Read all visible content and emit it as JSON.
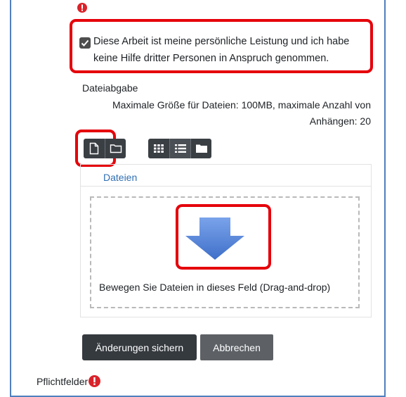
{
  "declaration": {
    "checked": true,
    "text": "Diese Arbeit ist meine persönliche Leistung und ich habe keine Hilfe dritter Personen in Anspruch genommen."
  },
  "file_submission": {
    "label": "Dateiabgabe",
    "limits": "Maximale Größe für Dateien: 100MB, maximale Anzahl von Anhängen: 20"
  },
  "toolbar": {
    "icons": [
      "file-icon",
      "folder-icon",
      "grid-view-icon",
      "list-view-icon",
      "folder-view-icon"
    ]
  },
  "file_panel": {
    "breadcrumb": "Dateien",
    "drop_text": "Bewegen Sie Dateien in dieses Feld (Drag-and-drop)"
  },
  "actions": {
    "save_label": "Änderungen sichern",
    "cancel_label": "Abbrechen"
  },
  "footer": {
    "required_label": "Pflichtfelder"
  },
  "colors": {
    "highlight": "#e5000a",
    "link": "#2f6fb3",
    "required": "#d9232a",
    "arrow": "#4f80d6",
    "frame": "#4f7fbf"
  }
}
